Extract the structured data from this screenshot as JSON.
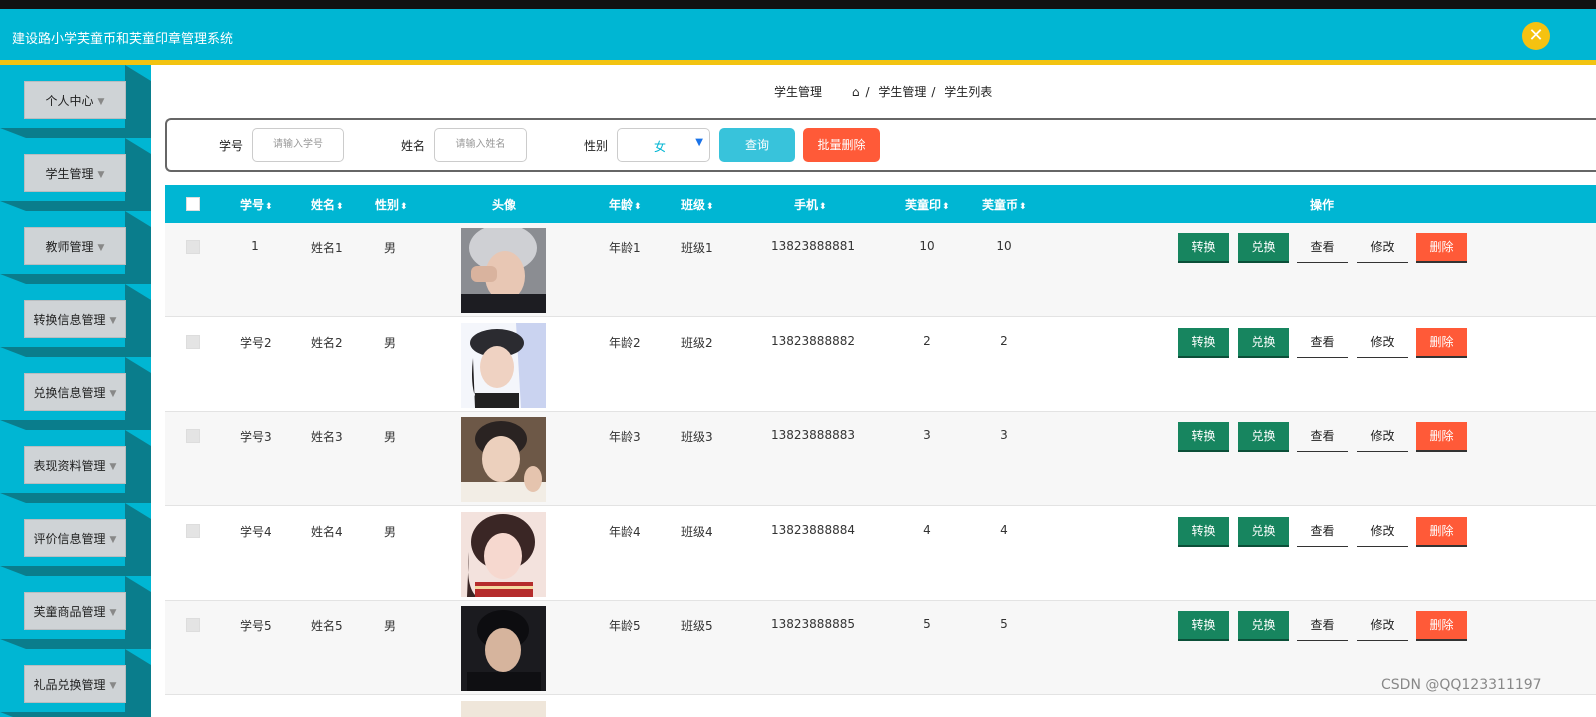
{
  "header": {
    "title": "建设路小学芙童币和芙童印章管理系统"
  },
  "sidebar": {
    "items": [
      {
        "label": "个人中心"
      },
      {
        "label": "学生管理"
      },
      {
        "label": "教师管理"
      },
      {
        "label": "转换信息管理"
      },
      {
        "label": "兑换信息管理"
      },
      {
        "label": "表现资料管理"
      },
      {
        "label": "评价信息管理"
      },
      {
        "label": "芙童商品管理"
      },
      {
        "label": "礼品兑换管理"
      }
    ]
  },
  "breadcrumb": {
    "title": "学生管理",
    "path": [
      "学生管理",
      "学生列表"
    ],
    "separator": "/"
  },
  "search": {
    "xuehao_label": "学号",
    "xuehao_placeholder": "请输入学号",
    "xingming_label": "姓名",
    "xingming_placeholder": "请输入姓名",
    "xingbie_label": "性别",
    "xingbie_value": "女",
    "query_label": "查询",
    "batch_delete_label": "批量删除"
  },
  "table": {
    "columns": [
      "学号",
      "姓名",
      "性别",
      "头像",
      "年龄",
      "班级",
      "手机",
      "芙童印",
      "芙童币",
      "操作"
    ],
    "sort_glyph": "⬍",
    "actions": {
      "convert": "转换",
      "exchange": "兑换",
      "view": "查看",
      "edit": "修改",
      "delete": "删除"
    },
    "rows": [
      {
        "xuehao": "1",
        "xingming": "姓名1",
        "xingbie": "男",
        "nianling": "年龄1",
        "banji": "班级1",
        "shouji": "13823888881",
        "futongyin": "10",
        "futongbi": "10"
      },
      {
        "xuehao": "学号2",
        "xingming": "姓名2",
        "xingbie": "男",
        "nianling": "年龄2",
        "banji": "班级2",
        "shouji": "13823888882",
        "futongyin": "2",
        "futongbi": "2"
      },
      {
        "xuehao": "学号3",
        "xingming": "姓名3",
        "xingbie": "男",
        "nianling": "年龄3",
        "banji": "班级3",
        "shouji": "13823888883",
        "futongyin": "3",
        "futongbi": "3"
      },
      {
        "xuehao": "学号4",
        "xingming": "姓名4",
        "xingbie": "男",
        "nianling": "年龄4",
        "banji": "班级4",
        "shouji": "13823888884",
        "futongyin": "4",
        "futongbi": "4"
      },
      {
        "xuehao": "学号5",
        "xingming": "姓名5",
        "xingbie": "男",
        "nianling": "年龄5",
        "banji": "班级5",
        "shouji": "13823888885",
        "futongyin": "5",
        "futongbi": "5"
      }
    ]
  },
  "watermark": "CSDN @QQ123311197",
  "colors": {
    "primary": "#00b6d3",
    "accent": "#f5c211",
    "green": "#17855f",
    "red": "#ff5a38"
  }
}
